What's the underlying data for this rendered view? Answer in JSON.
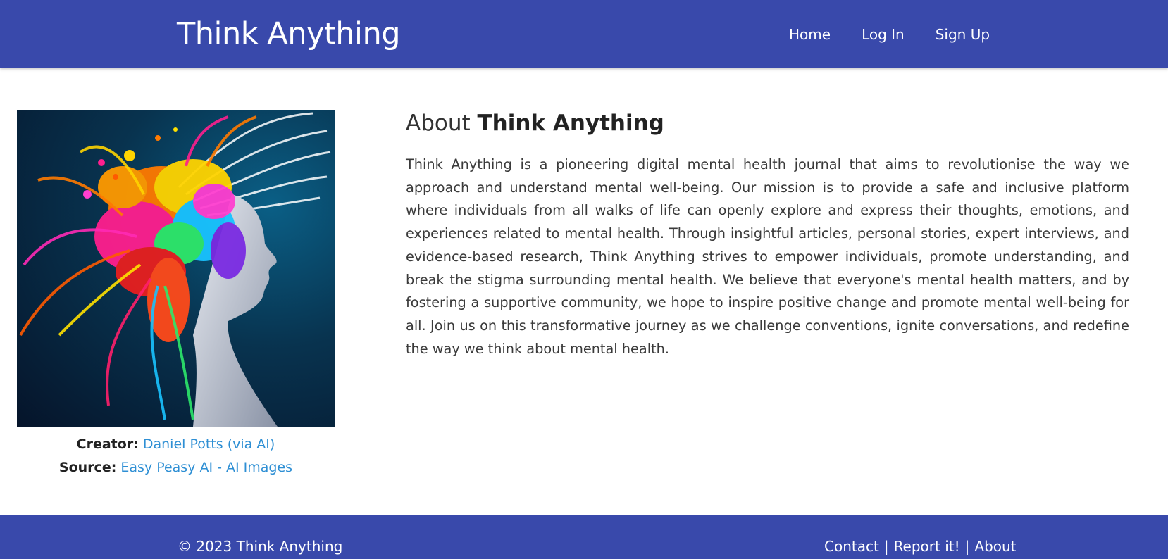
{
  "header": {
    "brand": "Think Anything",
    "nav": [
      "Home",
      "Log In",
      "Sign Up"
    ]
  },
  "image_credits": {
    "creator_label": "Creator:",
    "creator_link": "Daniel Potts (via AI)",
    "source_label": "Source:",
    "source_link": "Easy Peasy AI - AI Images"
  },
  "about": {
    "title_prefix": "About ",
    "title_strong": "Think Anything",
    "body": "Think Anything is a pioneering digital mental health journal that aims to revolutionise the way we approach and understand mental well-being. Our mission is to provide a safe and inclusive platform where individuals from all walks of life can openly explore and express their thoughts, emotions, and experiences related to mental health. Through insightful articles, personal stories, expert interviews, and evidence-based research, Think Anything strives to empower individuals, promote understanding, and break the stigma surrounding mental health. We believe that everyone's mental health matters, and by fostering a supportive community, we hope to inspire positive change and promote mental well-being for all. Join us on this transformative journey as we challenge conventions, ignite conversations, and redefine the way we think about mental health."
  },
  "footer": {
    "copyright": "© 2023 Think Anything",
    "links": [
      "Contact",
      "Report it!",
      "About"
    ],
    "separator": "|"
  },
  "colors": {
    "primary": "#3949ab",
    "link": "#2e8fd4",
    "text": "#333333"
  }
}
